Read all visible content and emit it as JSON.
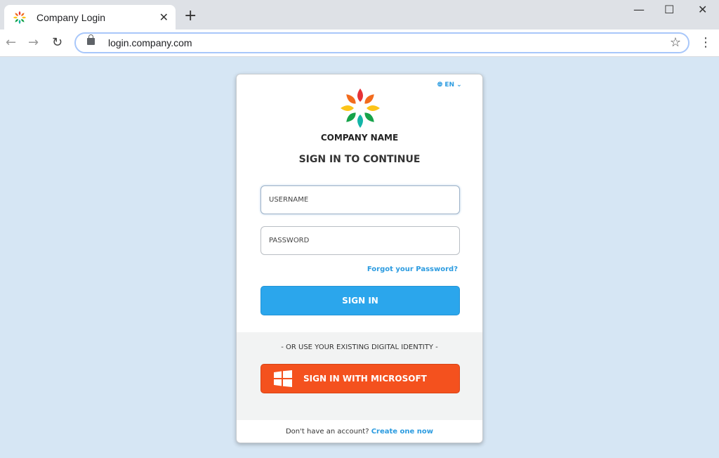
{
  "browser": {
    "tab_title": "Company Login",
    "url": "login.company.com",
    "new_tab": "+",
    "close": "✕",
    "minimize": "—",
    "maximize": "☐",
    "window_close": "✕",
    "back": "←",
    "forward": "→",
    "reload": "↻",
    "star": "☆",
    "menu": "⋮"
  },
  "login": {
    "language": "EN",
    "company_name": "COMPANY NAME",
    "heading": "SIGN IN TO CONTINUE",
    "username_placeholder": "USERNAME",
    "password_placeholder": "PASSWORD",
    "forgot": "Forgot your Password?",
    "signin": "SIGN IN",
    "or_text": "- OR USE YOUR EXISTING DIGITAL IDENTITY -",
    "microsoft": "SIGN IN WITH MICROSOFT",
    "no_account": "Don't have an account?",
    "create": "Create one now"
  },
  "colors": {
    "accent": "#2ba6ec",
    "microsoft": "#f4511e",
    "background": "#d6e6f4"
  }
}
